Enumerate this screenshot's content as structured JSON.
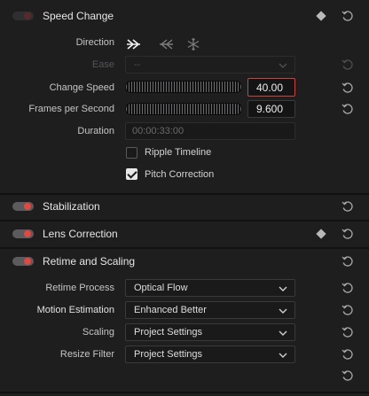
{
  "speed_change": {
    "title": "Speed Change",
    "direction_label": "Direction",
    "direction_icons": [
      "forward-arrow-icon",
      "reverse-arrow-icon",
      "freeze-frame-icon"
    ],
    "ease_label": "Ease",
    "ease_value": "--",
    "change_speed_label": "Change Speed",
    "change_speed_value": "40.00",
    "fps_label": "Frames per Second",
    "fps_value": "9.600",
    "duration_label": "Duration",
    "duration_value": "00:00:33:00",
    "ripple_label": "Ripple Timeline",
    "ripple_checked": false,
    "pitch_label": "Pitch Correction",
    "pitch_checked": true
  },
  "stabilization": {
    "title": "Stabilization"
  },
  "lens_correction": {
    "title": "Lens Correction"
  },
  "retime": {
    "title": "Retime and Scaling",
    "process_label": "Retime Process",
    "process_value": "Optical Flow",
    "motion_label": "Motion Estimation",
    "motion_value": "Enhanced Better",
    "scaling_label": "Scaling",
    "scaling_value": "Project Settings",
    "resize_label": "Resize Filter",
    "resize_value": "Project Settings"
  },
  "colors": {
    "toggle_on": "#e3473f",
    "active_border": "#c9443f",
    "background": "#1e1e1f"
  }
}
